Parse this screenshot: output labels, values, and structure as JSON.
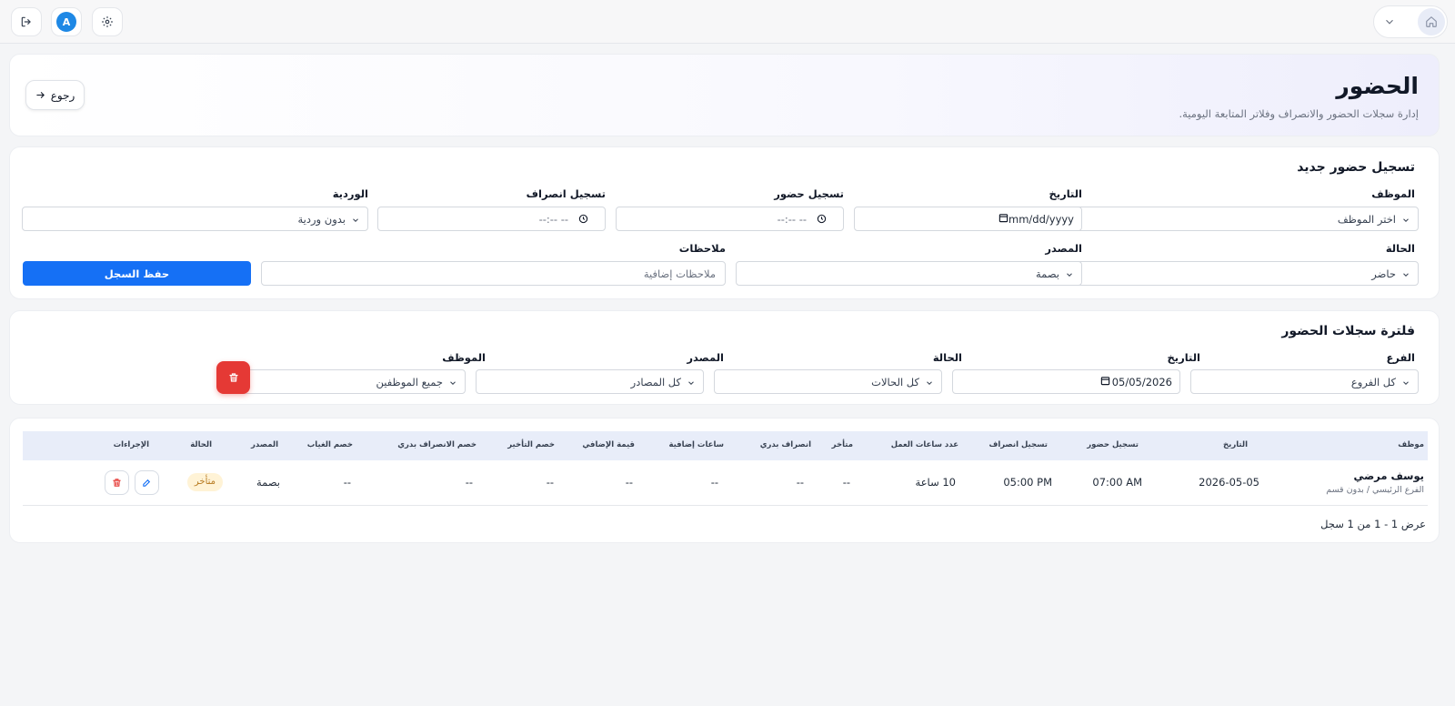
{
  "topbar": {
    "avatar_letter": "A",
    "icons": [
      "logout-icon",
      "gear-icon",
      "home-icon",
      "chevron-down-icon"
    ]
  },
  "header": {
    "title": "الحضور",
    "subtitle": "إدارة سجلات الحضور والانصراف وفلاتر المتابعة اليومية.",
    "back_label": "رجوع"
  },
  "new_record": {
    "title": "تسجيل حضور جديد",
    "employee": {
      "label": "الموظف",
      "value": "اختر الموظف"
    },
    "date": {
      "label": "التاريخ",
      "placeholder": "mm/dd/yyyy"
    },
    "check_in": {
      "label": "تسجيل حضور",
      "placeholder": "--:-- --"
    },
    "check_out": {
      "label": "تسجيل انصراف",
      "placeholder": "--:-- --"
    },
    "shift": {
      "label": "الوردية",
      "value": "بدون وردية"
    },
    "status": {
      "label": "الحالة",
      "value": "حاضر"
    },
    "source": {
      "label": "المصدر",
      "value": "بصمة"
    },
    "notes": {
      "label": "ملاحظات",
      "placeholder": "ملاحظات إضافية"
    },
    "save_label": "حفظ السجل"
  },
  "filters": {
    "title": "فلترة سجلات الحضور",
    "branch": {
      "label": "الفرع",
      "value": "كل الفروع"
    },
    "date": {
      "label": "التاريخ",
      "value": "05/05/2026"
    },
    "status": {
      "label": "الحالة",
      "value": "كل الحالات"
    },
    "source": {
      "label": "المصدر",
      "value": "كل المصادر"
    },
    "employee": {
      "label": "الموظف",
      "value": "جميع الموظفين"
    }
  },
  "table": {
    "columns": {
      "employee": "موظف",
      "date": "التاريخ",
      "check_in": "تسجيل حضور",
      "check_out": "تسجيل انصراف",
      "work_hours": "عدد ساعات العمل",
      "late": "متأخر",
      "early_leave": "انصراف بدري",
      "overtime_hours": "ساعات إضافية",
      "overtime_value": "قيمة الإضافي",
      "late_deduction": "خصم التأخير",
      "early_leave_deduction": "خصم الانصراف بدري",
      "absence_deduction": "خصم الغياب",
      "source": "المصدر",
      "status": "الحالة",
      "actions": "الإجراءات"
    },
    "rows": [
      {
        "name": "يوسف مرضي",
        "dept": "الفرع الرئيسي / بدون قسم",
        "date": "2026-05-05",
        "check_in": "07:00 AM",
        "check_out": "05:00 PM",
        "work_hours": "10 ساعة",
        "late": "--",
        "early_leave": "--",
        "overtime_hours": "--",
        "overtime_value": "--",
        "late_deduction": "--",
        "early_leave_deduction": "--",
        "absence_deduction": "--",
        "source": "بصمة",
        "status": "متأخر"
      }
    ],
    "footer": "عرض 1 - 1 من 1 سجل"
  },
  "colors": {
    "primary": "#1570f5",
    "danger": "#e53935",
    "avatar": "#1e88e5",
    "badge_bg": "#fff3d6",
    "badge_text": "#b7791f",
    "table_header": "#e8edf9"
  }
}
